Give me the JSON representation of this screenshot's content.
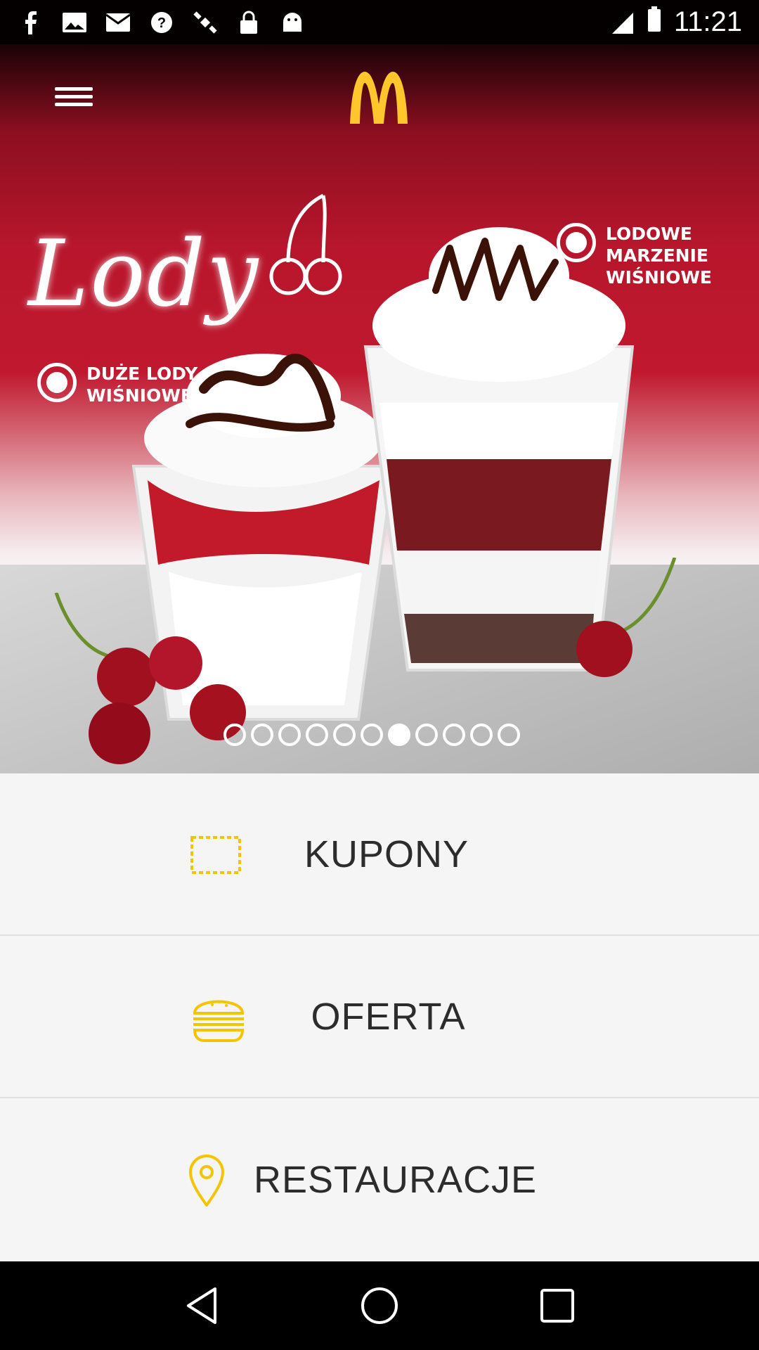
{
  "status_bar": {
    "time": "11:21",
    "icons": [
      "facebook-icon",
      "image-icon",
      "mail-icon",
      "help-icon",
      "satellite-icon",
      "lock-icon",
      "android-icon",
      "signal-icon",
      "battery-icon"
    ]
  },
  "header": {
    "menu_icon": "hamburger-icon",
    "logo": "mcdonalds-logo"
  },
  "banner": {
    "script_title": "Lody",
    "left_label": [
      "DUŻE LODY",
      "WIŚNIOWE"
    ],
    "right_label": [
      "LODOWE",
      "MARZENIE",
      "WIŚNIOWE"
    ],
    "slides_total": 11,
    "active_slide": 7
  },
  "menu": {
    "items": [
      {
        "label": "KUPONY",
        "icon": "coupon-icon"
      },
      {
        "label": "OFERTA",
        "icon": "burger-icon"
      },
      {
        "label": "RESTAURACJE",
        "icon": "location-pin-icon"
      }
    ]
  },
  "colors": {
    "brand_red": "#c0192f",
    "brand_yellow": "#ffc72c",
    "icon_yellow": "#f5c400"
  },
  "nav_bar": {
    "buttons": [
      "back-icon",
      "home-icon",
      "recents-icon"
    ]
  }
}
